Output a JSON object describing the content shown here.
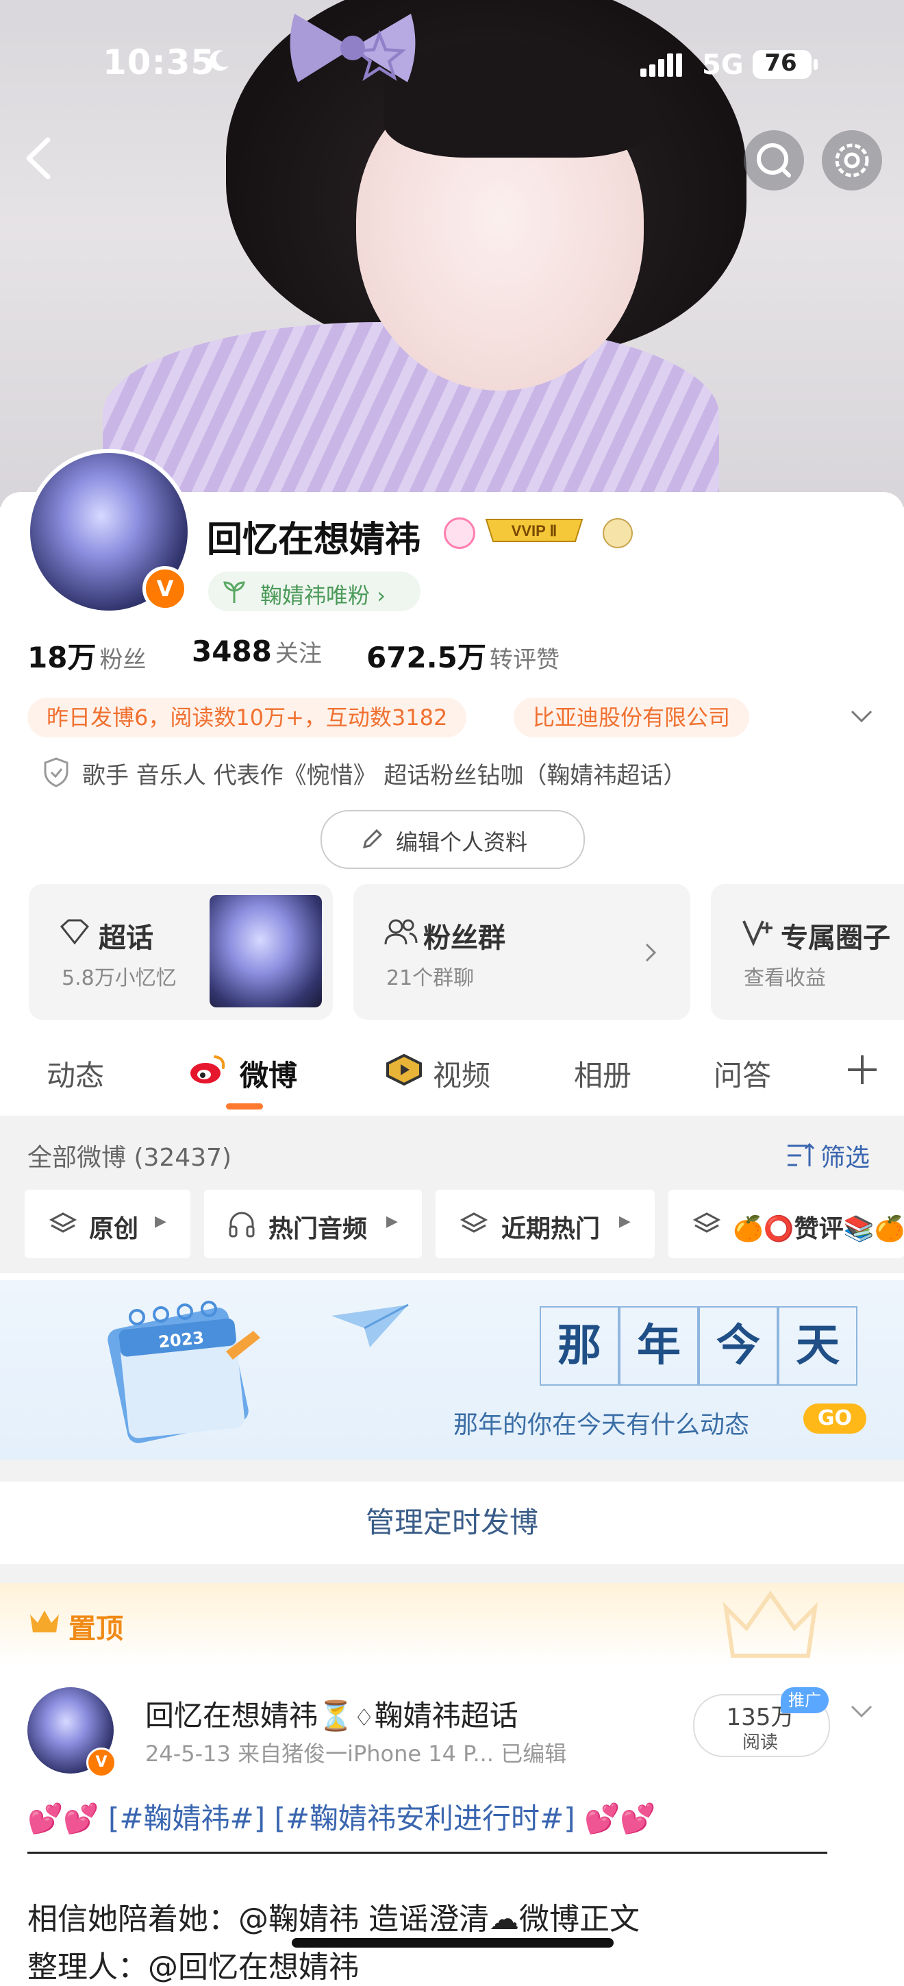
{
  "status_bar": {
    "time": "10:35",
    "network": "5G",
    "battery": "76"
  },
  "profile": {
    "name": "回忆在想婧祎",
    "vip_label": "VVIP Ⅱ",
    "fan_badge": "鞠婧祎唯粉",
    "stats": [
      {
        "value": "18万",
        "label": "粉丝"
      },
      {
        "value": "3488",
        "label": "关注"
      },
      {
        "value": "672.5万",
        "label": "转评赞"
      }
    ],
    "tags": [
      "昨日发博6，阅读数10万+，互动数3182",
      "比亚迪股份有限公司"
    ],
    "bio": "歌手 音乐人 代表作《惋惜》 超话粉丝钻咖（鞠婧祎超话）",
    "edit_button": "编辑个人资料"
  },
  "features": [
    {
      "title": "超话",
      "subtitle": "5.8万小忆忆"
    },
    {
      "title": "粉丝群",
      "subtitle": "21个群聊"
    },
    {
      "title": "专属圈子",
      "subtitle": "查看收益"
    }
  ],
  "tabs": [
    "动态",
    "微博",
    "视频",
    "相册",
    "问答"
  ],
  "filter": {
    "title": "全部微博 (32437)",
    "action": "筛选",
    "chips": [
      "原创",
      "热门音频",
      "近期热门",
      "🍊⭕赞评📚🍊"
    ]
  },
  "banner": {
    "chars": [
      "那",
      "年",
      "今",
      "天"
    ],
    "subtitle": "那年的你在今天有什么动态",
    "go": "GO",
    "year": "2023"
  },
  "manage_label": "管理定时发博",
  "pinned_label": "置顶",
  "post": {
    "name": "回忆在想婧祎",
    "topic": "鞠婧祎超话",
    "meta": "24-5-13  来自猪俊一iPhone 14 P...  已编辑",
    "reads": "135万",
    "reads_label": "阅读",
    "promo": "推广",
    "line1": "💕💕 [#鞠婧祎#]  [#鞠婧祎安利进行时#] 💕💕",
    "line2": "相信她陪着她：@鞠婧祎 造谣澄清☁微博正文",
    "line3": "整理人：@回忆在想婧祎"
  },
  "colors": {
    "accent": "#ff7a2f",
    "link": "#3a66b0",
    "banner_text": "#3b6ea6"
  }
}
